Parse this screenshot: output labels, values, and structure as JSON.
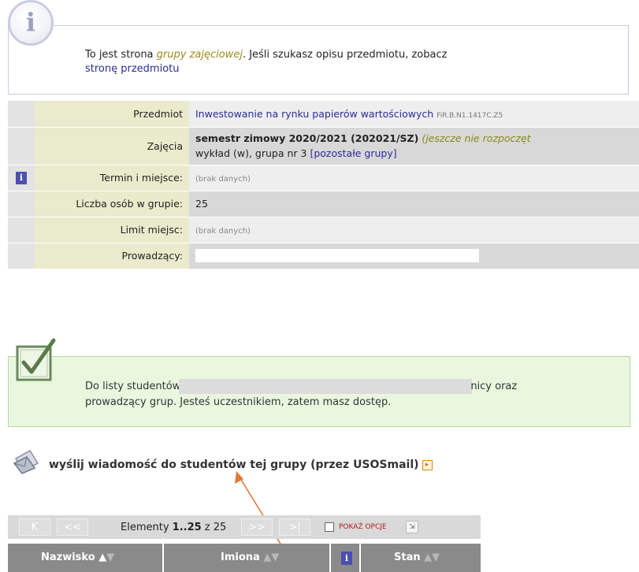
{
  "info_box": {
    "icon": "info-icon",
    "text_before": "To jest strona ",
    "text_link_italic": "grupy zajęciowej",
    "text_middle": ". Jeśli szukasz opisu przedmiotu, zobacz",
    "text_link": "stronę przedmiotu"
  },
  "table": {
    "rows": [
      {
        "label": "Przedmiot",
        "value": "Inwestowanie na rynku papierów wartościowych",
        "extra": "FiR.B.N1.1417C.Z5"
      },
      {
        "label": "Zajęcia",
        "value_bold": "semestr zimowy 2020/2021 (202021/SZ)",
        "value_italic": "(jeszcze nie rozpoczęt",
        "value_line2": "wykład (w), grupa nr 3",
        "value_line2_link": "[pozostałe grupy]"
      },
      {
        "label": "Termin i miejsce:",
        "value": "(brak danych)",
        "icon": "info-icon"
      },
      {
        "label": "Liczba osób w grupie:",
        "value": "25"
      },
      {
        "label": "Limit miejsc:",
        "value": "(brak danych)"
      },
      {
        "label": "Prowadzący:",
        "value": ""
      }
    ]
  },
  "access_box": {
    "icon": "checkmark-icon",
    "line1_start": "Do listy studentów",
    "line1_end": "nicy oraz",
    "line2": "prowadzący grup. Jesteś uczestnikiem, zatem masz dostęp."
  },
  "mail": {
    "icon": "mail-icon",
    "link": "wyślij wiadomość do studentów tej grupy (przez USOSmail)",
    "ext_icon": "external-link-icon"
  },
  "pager": {
    "first": "K",
    "prev": "<<",
    "label_prefix": "Elementy ",
    "range": "1..25",
    "label_suffix": " z 25",
    "next": ">>",
    "last": ">|",
    "options_label": "POKAŻ OPCJE"
  },
  "columns": {
    "surname": "Nazwisko",
    "names": "Imiona",
    "status": "Stan",
    "sort_up": "▲",
    "sort_down": "▼"
  },
  "colors": {
    "link": "#2b2b9e",
    "accent_olive": "#9a8a1a",
    "label_bg": "#eaeacc",
    "green_box": "#e9f7df",
    "arrow": "#e07a3a"
  }
}
